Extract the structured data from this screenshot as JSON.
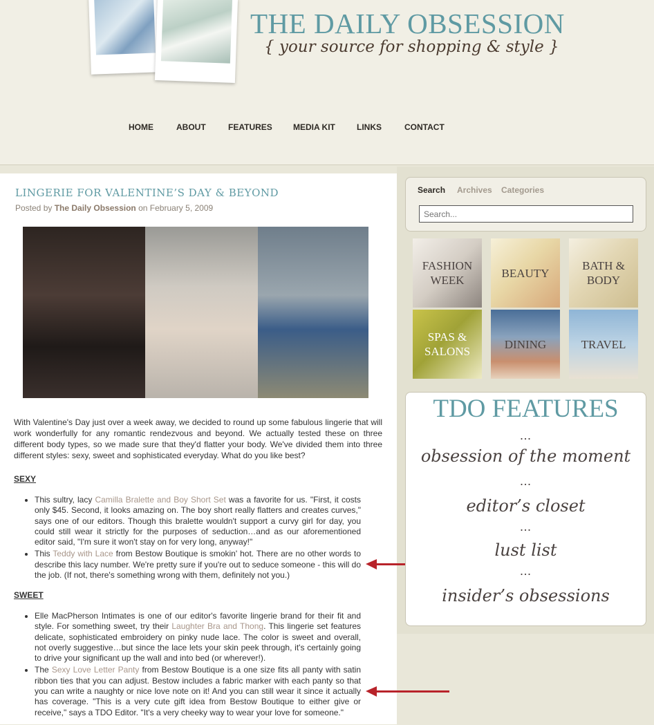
{
  "site": {
    "title": "THE DAILY OBSESSION",
    "tagline": "{ your source for shopping & style }"
  },
  "nav": {
    "items": [
      "HOME",
      "ABOUT",
      "FEATURES",
      "MEDIA KIT",
      "LINKS",
      "CONTACT"
    ]
  },
  "post": {
    "title": "LINGERIE FOR VALENTINE’S DAY & BEYOND",
    "byline_prefix": "Posted by",
    "author": "The Daily Obsession",
    "date": "on February 5, 2009",
    "intro": "With Valentine's Day just over a week away, we decided to round up some fabulous lingerie that will work wonderfully for any romantic rendezvous and beyond.  We actually tested these on three different body types, so we made sure that they'd flatter your body. We've divided them into three different styles: sexy, sweet and sophisticated everyday. What do you like best?",
    "sections": [
      {
        "heading": "SEXY",
        "items": [
          {
            "before": "This sultry, lacy ",
            "link": "Camilla Bralette and Boy Short Set",
            "after": " was a favorite for us.  \"First, it costs only $45. Second, it looks amazing on. The boy short really flatters and creates curves,\" says one of our editors.  Though this bralette wouldn't support a curvy girl for day, you could still wear it strictly for the purposes of seduction…and as our aforementioned editor said, \"I'm sure it won't stay on for very long, anyway!\""
          },
          {
            "before": "This ",
            "link": "Teddy with Lace",
            "after": " from Bestow Boutique is smokin' hot.  There are no other words to describe this lacy number.  We're pretty sure if you're out to seduce someone - this will do the job.  (If not, there's something wrong with them, definitely not you.)"
          }
        ]
      },
      {
        "heading": "SWEET",
        "items": [
          {
            "before": "Elle MacPherson Intimates is one of our editor's favorite lingerie brand for their fit and style. For something sweet, try their ",
            "link": "Laughter Bra and Thong",
            "after": ". This lingerie set features delicate, sophisticated embroidery on pinky nude lace.  The color is sweet and overall, not overly suggestive…but since the lace lets your skin peek through, it's certainly going to drive your significant up the wall and into bed (or wherever!)."
          },
          {
            "before": "The ",
            "link": "Sexy Love Letter Panty",
            "after": " from Bestow Boutique is a one size fits all panty with satin ribbon ties that you can adjust. Bestow includes a fabric marker with each panty so that you can write a naughty or nice love note on it! And you can still wear it since it actually has coverage.  \"This is a very cute gift idea from Bestow Boutique to either give or receive,\" says a TDO Editor. \"It's a very cheeky way to wear your love for someone.\""
          }
        ]
      }
    ]
  },
  "sidebar": {
    "tabs": [
      "Search",
      "Archives",
      "Categories"
    ],
    "search_placeholder": "Search...",
    "tiles": [
      "FASHION WEEK",
      "BEAUTY",
      "BATH & BODY",
      "SPAS & SALONS",
      "DINING",
      "TRAVEL"
    ],
    "features_title": "TDO FEATURES",
    "features": [
      "obsession of the moment",
      "editor’s closet",
      "lust list",
      "insider’s obsessions"
    ],
    "dots": "..."
  },
  "colors": {
    "accent": "#5f9aa3",
    "link": "#a8968a",
    "arrow": "#b8232a",
    "background": "#efede2"
  }
}
